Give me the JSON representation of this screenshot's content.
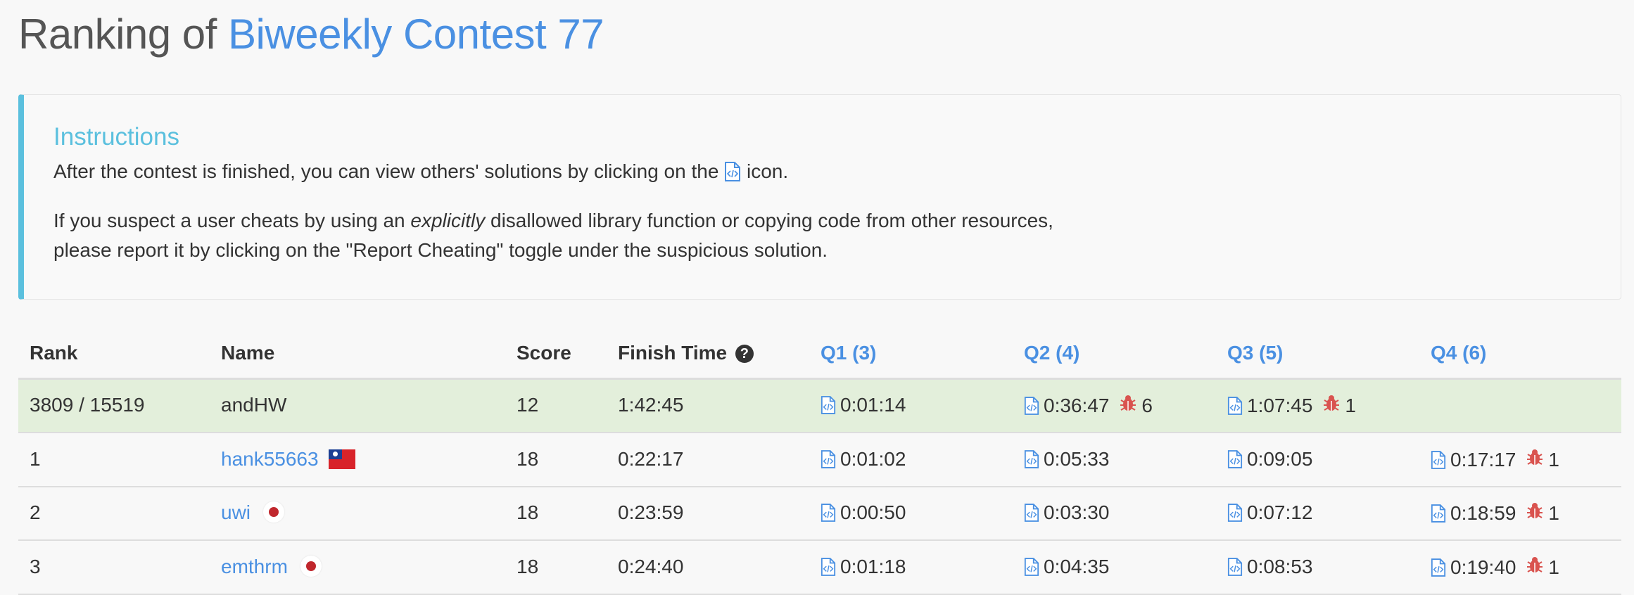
{
  "header": {
    "title_prefix": "Ranking of",
    "contest_name": "Biweekly Contest 77"
  },
  "instructions": {
    "title": "Instructions",
    "line1_before": "After the contest is finished, you can view others' solutions by clicking on the",
    "line1_after": "icon.",
    "line2_before": "If you suspect a user cheats by using an",
    "line2_em": "explicitly",
    "line2_after": "disallowed library function or copying code from other resources,",
    "line3": "please report it by clicking on the \"Report Cheating\" toggle under the suspicious solution."
  },
  "table": {
    "headers": {
      "rank": "Rank",
      "name": "Name",
      "score": "Score",
      "finish_time": "Finish Time",
      "q1": "Q1 (3)",
      "q2": "Q2 (4)",
      "q3": "Q3 (5)",
      "q4": "Q4 (6)"
    },
    "rows": [
      {
        "rank": "3809 / 15519",
        "name": "andHW",
        "score": "12",
        "finish": "1:42:45",
        "q1": {
          "time": "0:01:14",
          "wrong": ""
        },
        "q2": {
          "time": "0:36:47",
          "wrong": "6"
        },
        "q3": {
          "time": "1:07:45",
          "wrong": "1"
        },
        "q4": {
          "time": "",
          "wrong": ""
        }
      },
      {
        "rank": "1",
        "name": "hank55663",
        "flag": "taiwan-flag-icon",
        "score": "18",
        "finish": "0:22:17",
        "q1": {
          "time": "0:01:02",
          "wrong": ""
        },
        "q2": {
          "time": "0:05:33",
          "wrong": ""
        },
        "q3": {
          "time": "0:09:05",
          "wrong": ""
        },
        "q4": {
          "time": "0:17:17",
          "wrong": "1"
        }
      },
      {
        "rank": "2",
        "name": "uwi",
        "flag": "japan-flag-icon",
        "score": "18",
        "finish": "0:23:59",
        "q1": {
          "time": "0:00:50",
          "wrong": ""
        },
        "q2": {
          "time": "0:03:30",
          "wrong": ""
        },
        "q3": {
          "time": "0:07:12",
          "wrong": ""
        },
        "q4": {
          "time": "0:18:59",
          "wrong": "1"
        }
      },
      {
        "rank": "3",
        "name": "emthrm",
        "flag": "japan-flag-icon",
        "score": "18",
        "finish": "0:24:40",
        "q1": {
          "time": "0:01:18",
          "wrong": ""
        },
        "q2": {
          "time": "0:04:35",
          "wrong": ""
        },
        "q3": {
          "time": "0:08:53",
          "wrong": ""
        },
        "q4": {
          "time": "0:19:40",
          "wrong": "1"
        }
      }
    ]
  },
  "colors": {
    "link": "#4a90e2",
    "info": "#5bc0de",
    "highlight_row": "#e3efdb",
    "bug": "#d9534f"
  }
}
